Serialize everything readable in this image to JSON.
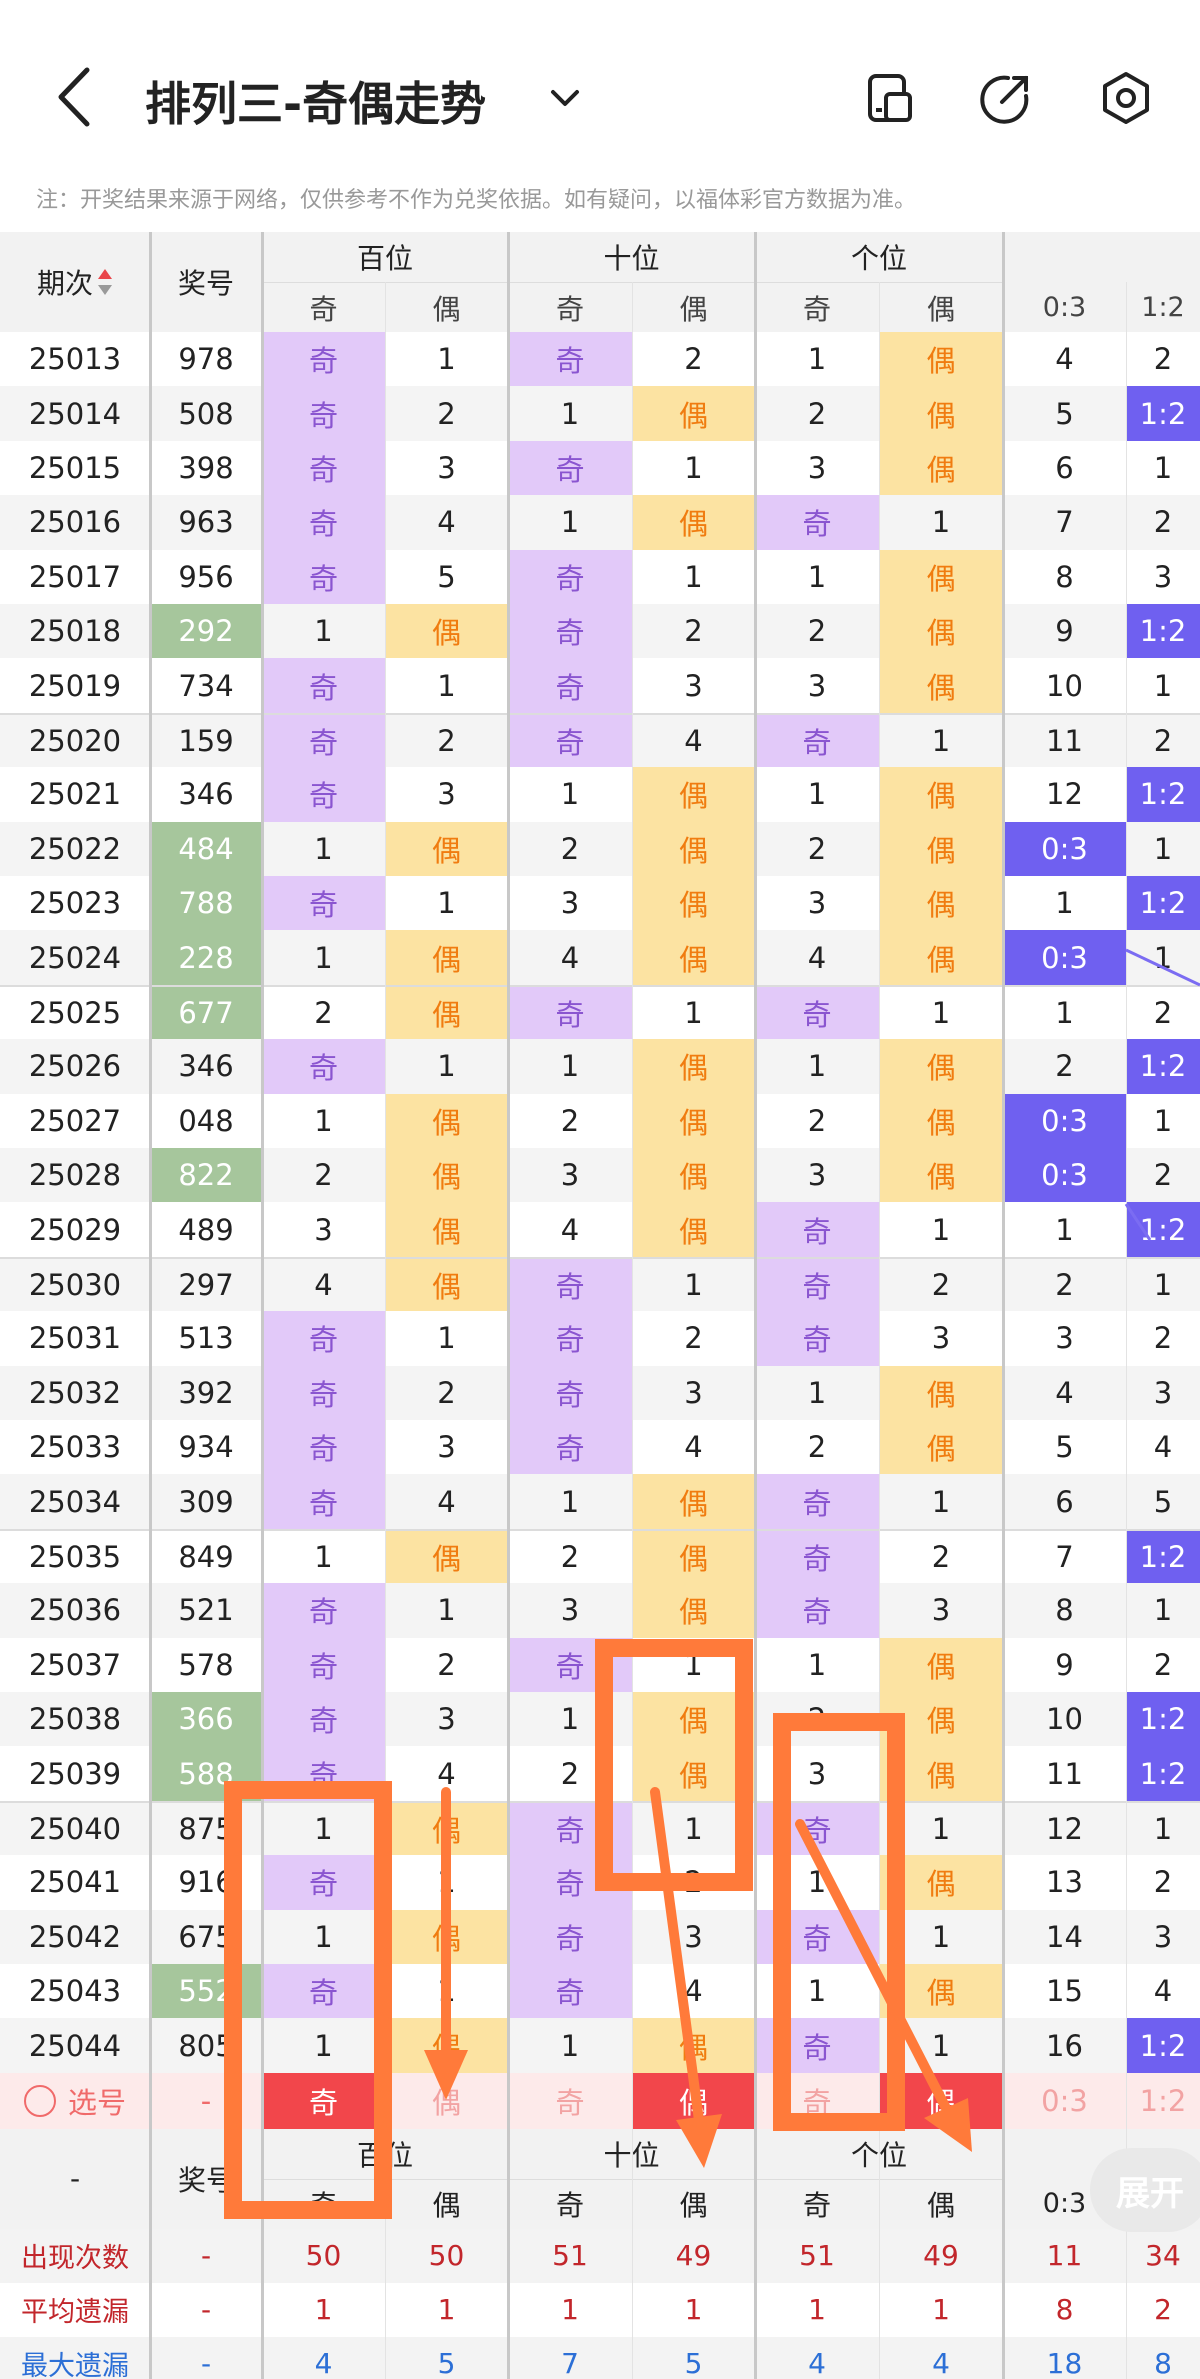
{
  "header": {
    "title": "排列三-奇偶走势",
    "notice": "注：开奖结果来源于网络，仅供参考不作为兑奖依据。如有疑问，以福体彩官方数据为准。"
  },
  "table": {
    "col_period": "期次",
    "col_number": "奖号",
    "groups": [
      "百位",
      "十位",
      "个位"
    ],
    "sub_odd": "奇",
    "sub_even": "偶",
    "ratio_cols": [
      "0:3",
      "1:2"
    ],
    "rows": [
      {
        "p": "25013",
        "n": "978",
        "ng": false,
        "h": [
          "奇",
          "1"
        ],
        "t": [
          "奇",
          "2"
        ],
        "u": [
          "1",
          "偶"
        ],
        "r": [
          "4",
          "2"
        ],
        "rb": [
          false,
          false
        ]
      },
      {
        "p": "25014",
        "n": "508",
        "ng": false,
        "h": [
          "奇",
          "2"
        ],
        "t": [
          "1",
          "偶"
        ],
        "u": [
          "2",
          "偶"
        ],
        "r": [
          "5",
          "1:2"
        ],
        "rb": [
          false,
          true
        ]
      },
      {
        "p": "25015",
        "n": "398",
        "ng": false,
        "h": [
          "奇",
          "3"
        ],
        "t": [
          "奇",
          "1"
        ],
        "u": [
          "3",
          "偶"
        ],
        "r": [
          "6",
          "1"
        ],
        "rb": [
          false,
          false
        ]
      },
      {
        "p": "25016",
        "n": "963",
        "ng": false,
        "h": [
          "奇",
          "4"
        ],
        "t": [
          "1",
          "偶"
        ],
        "u": [
          "奇",
          "1"
        ],
        "r": [
          "7",
          "2"
        ],
        "rb": [
          false,
          false
        ]
      },
      {
        "p": "25017",
        "n": "956",
        "ng": false,
        "h": [
          "奇",
          "5"
        ],
        "t": [
          "奇",
          "1"
        ],
        "u": [
          "1",
          "偶"
        ],
        "r": [
          "8",
          "3"
        ],
        "rb": [
          false,
          false
        ]
      },
      {
        "p": "25018",
        "n": "292",
        "ng": true,
        "h": [
          "1",
          "偶"
        ],
        "t": [
          "奇",
          "2"
        ],
        "u": [
          "2",
          "偶"
        ],
        "r": [
          "9",
          "1:2"
        ],
        "rb": [
          false,
          true
        ]
      },
      {
        "p": "25019",
        "n": "734",
        "ng": false,
        "h": [
          "奇",
          "1"
        ],
        "t": [
          "奇",
          "3"
        ],
        "u": [
          "3",
          "偶"
        ],
        "r": [
          "10",
          "1"
        ],
        "rb": [
          false,
          false
        ]
      },
      {
        "p": "25020",
        "n": "159",
        "ng": false,
        "h": [
          "奇",
          "2"
        ],
        "t": [
          "奇",
          "4"
        ],
        "u": [
          "奇",
          "1"
        ],
        "r": [
          "11",
          "2"
        ],
        "rb": [
          false,
          false
        ]
      },
      {
        "p": "25021",
        "n": "346",
        "ng": false,
        "h": [
          "奇",
          "3"
        ],
        "t": [
          "1",
          "偶"
        ],
        "u": [
          "1",
          "偶"
        ],
        "r": [
          "12",
          "1:2"
        ],
        "rb": [
          false,
          true
        ]
      },
      {
        "p": "25022",
        "n": "484",
        "ng": true,
        "h": [
          "1",
          "偶"
        ],
        "t": [
          "2",
          "偶"
        ],
        "u": [
          "2",
          "偶"
        ],
        "r": [
          "0:3",
          "1"
        ],
        "rb": [
          true,
          false
        ]
      },
      {
        "p": "25023",
        "n": "788",
        "ng": true,
        "h": [
          "奇",
          "1"
        ],
        "t": [
          "3",
          "偶"
        ],
        "u": [
          "3",
          "偶"
        ],
        "r": [
          "1",
          "1:2"
        ],
        "rb": [
          false,
          true
        ]
      },
      {
        "p": "25024",
        "n": "228",
        "ng": true,
        "h": [
          "1",
          "偶"
        ],
        "t": [
          "4",
          "偶"
        ],
        "u": [
          "4",
          "偶"
        ],
        "r": [
          "0:3",
          "1"
        ],
        "rb": [
          true,
          false
        ]
      },
      {
        "p": "25025",
        "n": "677",
        "ng": true,
        "h": [
          "2",
          "偶"
        ],
        "t": [
          "奇",
          "1"
        ],
        "u": [
          "奇",
          "1"
        ],
        "r": [
          "1",
          "2"
        ],
        "rb": [
          false,
          false
        ]
      },
      {
        "p": "25026",
        "n": "346",
        "ng": false,
        "h": [
          "奇",
          "1"
        ],
        "t": [
          "1",
          "偶"
        ],
        "u": [
          "1",
          "偶"
        ],
        "r": [
          "2",
          "1:2"
        ],
        "rb": [
          false,
          true
        ]
      },
      {
        "p": "25027",
        "n": "048",
        "ng": false,
        "h": [
          "1",
          "偶"
        ],
        "t": [
          "2",
          "偶"
        ],
        "u": [
          "2",
          "偶"
        ],
        "r": [
          "0:3",
          "1"
        ],
        "rb": [
          true,
          false
        ]
      },
      {
        "p": "25028",
        "n": "822",
        "ng": true,
        "h": [
          "2",
          "偶"
        ],
        "t": [
          "3",
          "偶"
        ],
        "u": [
          "3",
          "偶"
        ],
        "r": [
          "0:3",
          "2"
        ],
        "rb": [
          true,
          false
        ]
      },
      {
        "p": "25029",
        "n": "489",
        "ng": false,
        "h": [
          "3",
          "偶"
        ],
        "t": [
          "4",
          "偶"
        ],
        "u": [
          "奇",
          "1"
        ],
        "r": [
          "1",
          "1:2"
        ],
        "rb": [
          false,
          true
        ]
      },
      {
        "p": "25030",
        "n": "297",
        "ng": false,
        "h": [
          "4",
          "偶"
        ],
        "t": [
          "奇",
          "1"
        ],
        "u": [
          "奇",
          "2"
        ],
        "r": [
          "2",
          "1"
        ],
        "rb": [
          false,
          false
        ]
      },
      {
        "p": "25031",
        "n": "513",
        "ng": false,
        "h": [
          "奇",
          "1"
        ],
        "t": [
          "奇",
          "2"
        ],
        "u": [
          "奇",
          "3"
        ],
        "r": [
          "3",
          "2"
        ],
        "rb": [
          false,
          false
        ]
      },
      {
        "p": "25032",
        "n": "392",
        "ng": false,
        "h": [
          "奇",
          "2"
        ],
        "t": [
          "奇",
          "3"
        ],
        "u": [
          "1",
          "偶"
        ],
        "r": [
          "4",
          "3"
        ],
        "rb": [
          false,
          false
        ]
      },
      {
        "p": "25033",
        "n": "934",
        "ng": false,
        "h": [
          "奇",
          "3"
        ],
        "t": [
          "奇",
          "4"
        ],
        "u": [
          "2",
          "偶"
        ],
        "r": [
          "5",
          "4"
        ],
        "rb": [
          false,
          false
        ]
      },
      {
        "p": "25034",
        "n": "309",
        "ng": false,
        "h": [
          "奇",
          "4"
        ],
        "t": [
          "1",
          "偶"
        ],
        "u": [
          "奇",
          "1"
        ],
        "r": [
          "6",
          "5"
        ],
        "rb": [
          false,
          false
        ]
      },
      {
        "p": "25035",
        "n": "849",
        "ng": false,
        "h": [
          "1",
          "偶"
        ],
        "t": [
          "2",
          "偶"
        ],
        "u": [
          "奇",
          "2"
        ],
        "r": [
          "7",
          "1:2"
        ],
        "rb": [
          false,
          true
        ]
      },
      {
        "p": "25036",
        "n": "521",
        "ng": false,
        "h": [
          "奇",
          "1"
        ],
        "t": [
          "3",
          "偶"
        ],
        "u": [
          "奇",
          "3"
        ],
        "r": [
          "8",
          "1"
        ],
        "rb": [
          false,
          false
        ]
      },
      {
        "p": "25037",
        "n": "578",
        "ng": false,
        "h": [
          "奇",
          "2"
        ],
        "t": [
          "奇",
          "1"
        ],
        "u": [
          "1",
          "偶"
        ],
        "r": [
          "9",
          "2"
        ],
        "rb": [
          false,
          false
        ]
      },
      {
        "p": "25038",
        "n": "366",
        "ng": true,
        "h": [
          "奇",
          "3"
        ],
        "t": [
          "1",
          "偶"
        ],
        "u": [
          "2",
          "偶"
        ],
        "r": [
          "10",
          "1:2"
        ],
        "rb": [
          false,
          true
        ]
      },
      {
        "p": "25039",
        "n": "588",
        "ng": true,
        "h": [
          "奇",
          "4"
        ],
        "t": [
          "2",
          "偶"
        ],
        "u": [
          "3",
          "偶"
        ],
        "r": [
          "11",
          "1:2"
        ],
        "rb": [
          false,
          true
        ]
      },
      {
        "p": "25040",
        "n": "875",
        "ng": false,
        "h": [
          "1",
          "偶"
        ],
        "t": [
          "奇",
          "1"
        ],
        "u": [
          "奇",
          "1"
        ],
        "r": [
          "12",
          "1"
        ],
        "rb": [
          false,
          false
        ]
      },
      {
        "p": "25041",
        "n": "916",
        "ng": false,
        "h": [
          "奇",
          "1"
        ],
        "t": [
          "奇",
          "2"
        ],
        "u": [
          "1",
          "偶"
        ],
        "r": [
          "13",
          "2"
        ],
        "rb": [
          false,
          false
        ]
      },
      {
        "p": "25042",
        "n": "675",
        "ng": false,
        "h": [
          "1",
          "偶"
        ],
        "t": [
          "奇",
          "3"
        ],
        "u": [
          "奇",
          "1"
        ],
        "r": [
          "14",
          "3"
        ],
        "rb": [
          false,
          false
        ]
      },
      {
        "p": "25043",
        "n": "552",
        "ng": true,
        "h": [
          "奇",
          "1"
        ],
        "t": [
          "奇",
          "4"
        ],
        "u": [
          "1",
          "偶"
        ],
        "r": [
          "15",
          "4"
        ],
        "rb": [
          false,
          false
        ]
      },
      {
        "p": "25044",
        "n": "805",
        "ng": false,
        "h": [
          "1",
          "偶"
        ],
        "t": [
          "1",
          "偶"
        ],
        "u": [
          "奇",
          "1"
        ],
        "r": [
          "16",
          "1:2"
        ],
        "rb": [
          false,
          true
        ]
      }
    ],
    "select_row": {
      "label": "选号",
      "dash": "-",
      "cells": [
        "奇",
        "偶",
        "奇",
        "偶",
        "奇",
        "偶",
        "0:3",
        "1:2"
      ]
    },
    "footer_period": "-",
    "footer_number": "奖号",
    "footer_ratio": "0:3",
    "stats": [
      {
        "label": "出现次数",
        "dash": "-",
        "vals": [
          "50",
          "50",
          "51",
          "49",
          "51",
          "49",
          "11",
          "34"
        ]
      },
      {
        "label": "平均遗漏",
        "dash": "-",
        "vals": [
          "1",
          "1",
          "1",
          "1",
          "1",
          "1",
          "8",
          "2"
        ]
      },
      {
        "label": "最大遗漏",
        "dash": "-",
        "vals": [
          "4",
          "5",
          "7",
          "5",
          "4",
          "4",
          "18",
          "8"
        ]
      }
    ]
  },
  "expand_label": "展开",
  "colors": {
    "odd": "#e2c9f9",
    "even": "#fce3a2",
    "green": "#a6c69c",
    "blue": "#6f60f0",
    "red": "#f2464b",
    "annot": "#ff7a3a"
  }
}
